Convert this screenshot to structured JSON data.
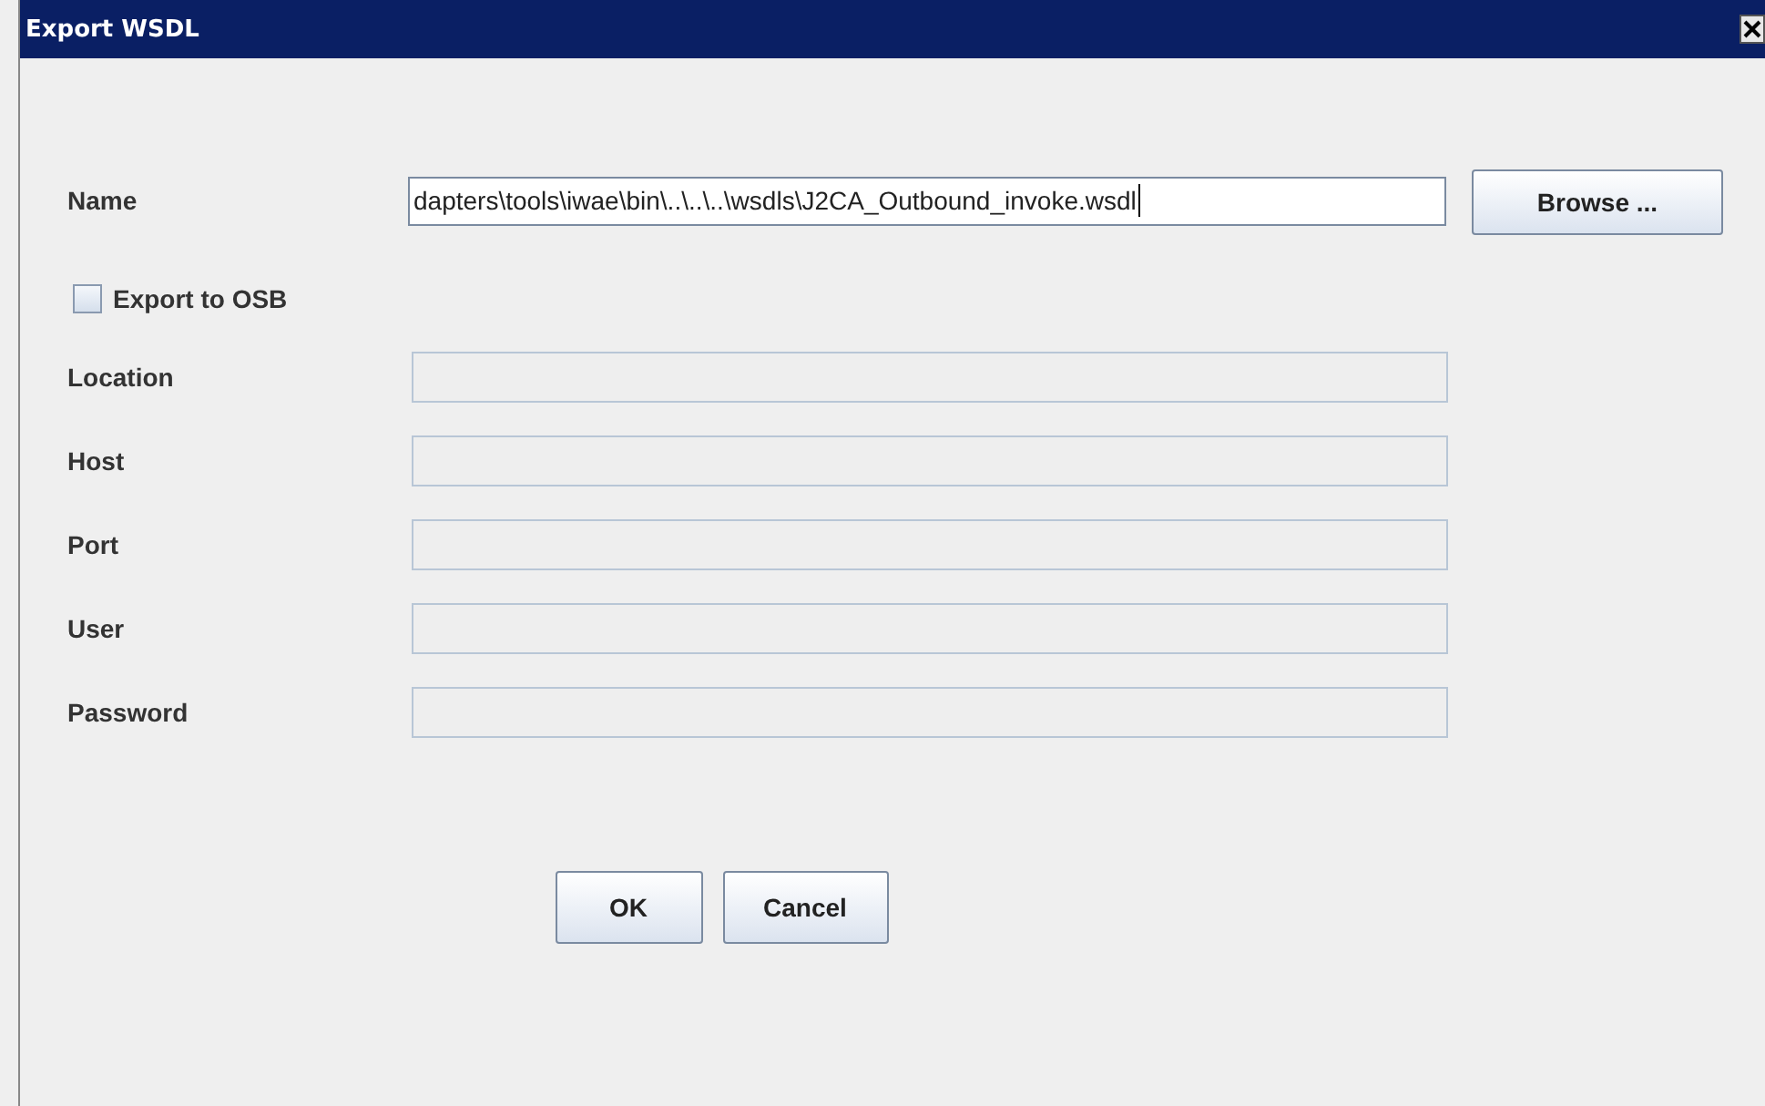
{
  "window": {
    "title": "Export WSDL"
  },
  "name_field": {
    "label": "Name",
    "value": "dapters\\tools\\iwae\\bin\\..\\..\\..\\wsdls\\J2CA_Outbound_invoke.wsdl",
    "button": "Browse ..."
  },
  "export_to_osb": {
    "label": "Export to OSB",
    "checked": false
  },
  "fields": [
    {
      "label": "Location",
      "disabled": true
    },
    {
      "label": "Host",
      "disabled": true
    },
    {
      "label": "Port",
      "disabled": true
    },
    {
      "label": "User",
      "disabled": true
    },
    {
      "label": "Password",
      "disabled": true
    }
  ],
  "buttons": [
    "OK",
    "Cancel"
  ]
}
